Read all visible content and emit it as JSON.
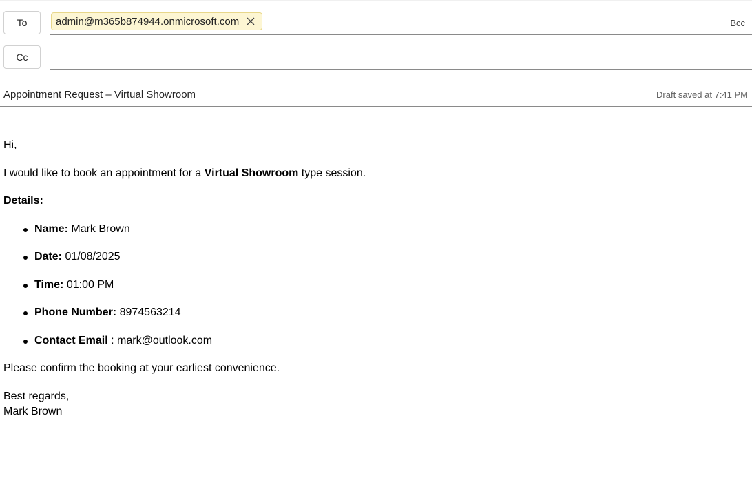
{
  "recipients": {
    "to_label": "To",
    "cc_label": "Cc",
    "bcc_label": "Bcc",
    "to_chips": [
      "admin@m365b874944.onmicrosoft.com"
    ],
    "cc_value": "",
    "chip_remove_icon": "close-icon"
  },
  "subject": {
    "value": "Appointment Request – Virtual Showroom",
    "draft_status": "Draft saved at 7:41 PM"
  },
  "body": {
    "greeting": "Hi,",
    "intro_before": "I would like to book an appointment for a ",
    "intro_bold": "Virtual Showroom",
    "intro_after": " type session.",
    "details_heading": "Details:",
    "details": [
      {
        "label": "Name:",
        "sep": " ",
        "value": "Mark Brown"
      },
      {
        "label": "Date:",
        "sep": " ",
        "value": "01/08/2025"
      },
      {
        "label": "Time:",
        "sep": " ",
        "value": "01:00 PM"
      },
      {
        "label": "Phone Number:",
        "sep": " ",
        "value": "8974563214"
      },
      {
        "label": "Contact Email",
        "sep": " : ",
        "value": "mark@outlook.com"
      }
    ],
    "confirm": "Please confirm the booking at your earliest convenience.",
    "closing": "Best regards,",
    "signature": "Mark Brown"
  },
  "colors": {
    "chip_bg": "#fdf6d3",
    "chip_border": "#e8d78a",
    "divider": "#8a8a8a"
  }
}
